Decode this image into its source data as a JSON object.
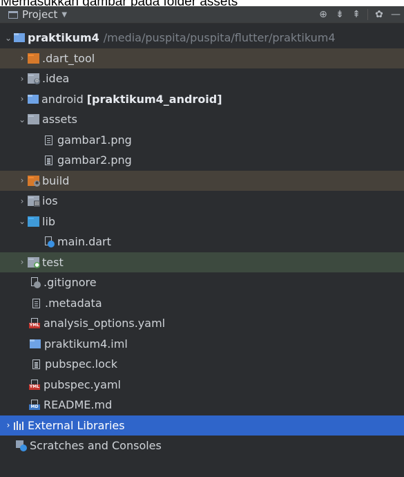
{
  "caption": "Memasukkan gambar pada folder assets",
  "toolbar": {
    "title": "Project",
    "title_icon": "project-window-icon",
    "dropdown_icon": "chevron-down-icon",
    "tools": [
      "target-icon",
      "expand-all-icon",
      "collapse-all-icon",
      "gear-icon",
      "minimize-icon"
    ]
  },
  "tree": {
    "root": {
      "name": "praktikum4",
      "path": "/media/puspita/puspita/flutter/praktikum4",
      "expanded": true
    },
    "items": [
      {
        "label": ".dart_tool",
        "icon": "folder-orange-icon",
        "expanded": false
      },
      {
        "label": ".idea",
        "icon": "folder-settings-icon",
        "expanded": false
      },
      {
        "label": "android",
        "suffix": "[praktikum4_android]",
        "icon": "folder-module-icon",
        "expanded": false
      },
      {
        "label": "assets",
        "icon": "folder-icon",
        "expanded": true
      },
      {
        "label": "gambar1.png",
        "icon": "image-file-icon"
      },
      {
        "label": "gambar2.png",
        "icon": "image-file-icon"
      },
      {
        "label": "build",
        "icon": "folder-excluded-icon",
        "expanded": false
      },
      {
        "label": "ios",
        "icon": "folder-module-icon",
        "expanded": false
      },
      {
        "label": "lib",
        "icon": "folder-source-icon",
        "expanded": true
      },
      {
        "label": "main.dart",
        "icon": "dart-file-icon"
      },
      {
        "label": "test",
        "icon": "folder-test-icon",
        "expanded": false
      },
      {
        "label": ".gitignore",
        "icon": "gitignore-file-icon"
      },
      {
        "label": ".metadata",
        "icon": "text-file-icon"
      },
      {
        "label": "analysis_options.yaml",
        "icon": "yaml-file-icon"
      },
      {
        "label": "praktikum4.iml",
        "icon": "iml-file-icon"
      },
      {
        "label": "pubspec.lock",
        "icon": "text-file-icon"
      },
      {
        "label": "pubspec.yaml",
        "icon": "yaml-file-icon"
      },
      {
        "label": "README.md",
        "icon": "markdown-file-icon"
      }
    ],
    "external_libraries": "External Libraries",
    "scratches": "Scratches and Consoles"
  },
  "colors": {
    "panel_bg": "#2b2d30",
    "selection": "#2f65ca",
    "excluded_row": "#46413a",
    "test_row": "#3d4a3f",
    "folder_orange": "#d6792b",
    "folder_blue": "#3f9ad8"
  }
}
